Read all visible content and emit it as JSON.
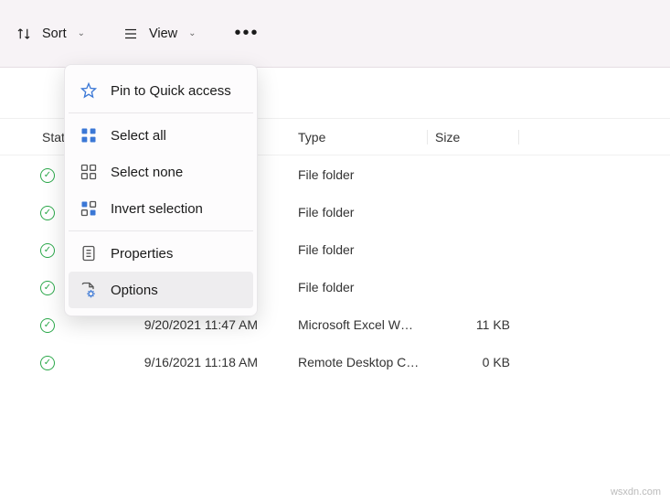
{
  "toolbar": {
    "sort_label": "Sort",
    "view_label": "View",
    "more_label": "•••"
  },
  "columns": {
    "status": "Stat",
    "date": "",
    "type": "Type",
    "size": "Size"
  },
  "rows": [
    {
      "status": "ok",
      "date": "",
      "type": "File folder",
      "size": ""
    },
    {
      "status": "ok",
      "date": "",
      "type": "File folder",
      "size": ""
    },
    {
      "status": "ok",
      "date": "",
      "type": "File folder",
      "size": ""
    },
    {
      "status": "ok",
      "date": "",
      "type": "File folder",
      "size": ""
    },
    {
      "status": "ok",
      "date": "9/20/2021 11:47 AM",
      "type": "Microsoft Excel W…",
      "size": "11 KB"
    },
    {
      "status": "ok",
      "date": "9/16/2021 11:18 AM",
      "type": "Remote Desktop C…",
      "size": "0 KB"
    }
  ],
  "menu": {
    "pin": "Pin to Quick access",
    "select_all": "Select all",
    "select_none": "Select none",
    "invert_selection": "Invert selection",
    "properties": "Properties",
    "options": "Options"
  },
  "watermark": "wsxdn.com"
}
